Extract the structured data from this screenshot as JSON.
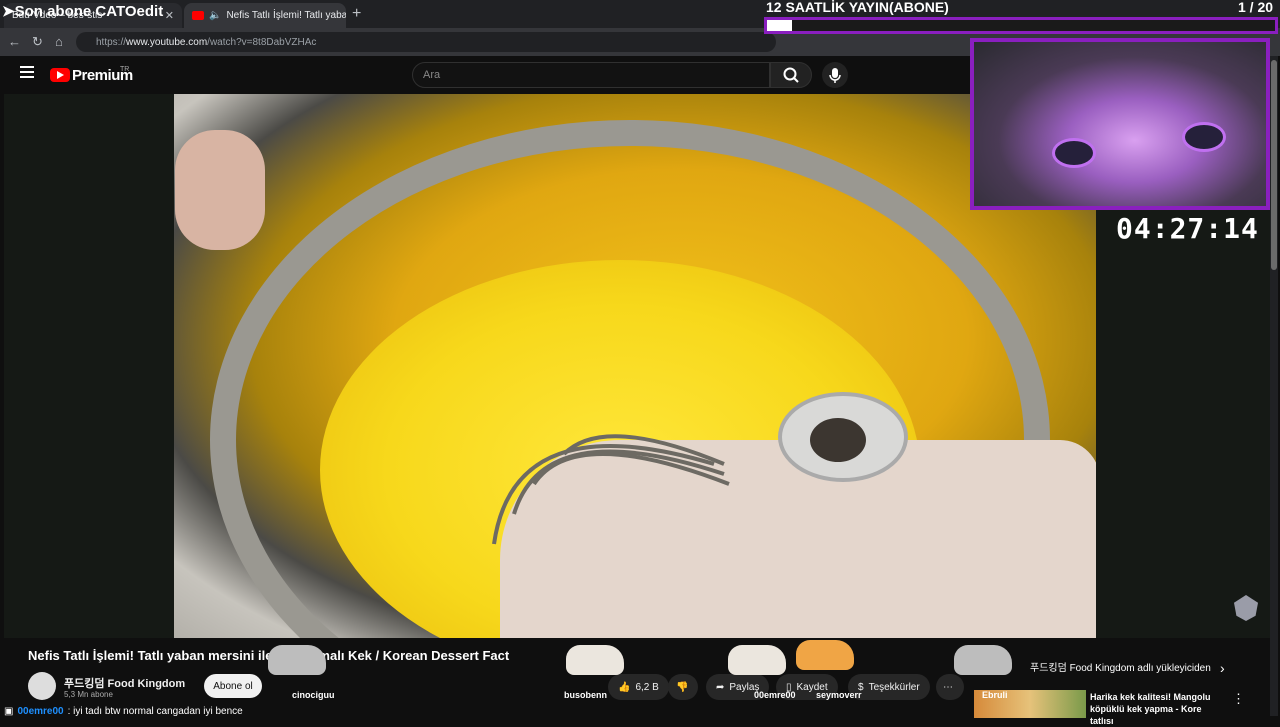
{
  "browser": {
    "tabs": [
      {
        "label": "Bdu·Vdeo – bes•stis"
      },
      {
        "label": "Nefis Tatlı İşlemi! Tatlı yaban mersini"
      }
    ],
    "new_tab": "+",
    "url_prefix": "https://",
    "url_host": "www.youtube.com",
    "url_path": "/watch?v=8t8DabVZHAc"
  },
  "youtube": {
    "logo_text": "Premium",
    "logo_suffix": "TR",
    "search_placeholder": "Ara"
  },
  "overlay": {
    "corner_text": "➤Son abone CATOedit",
    "stream_title": "12 SAATLİK YAYIN(ABONE)",
    "goal_counter": "1 / 20",
    "goal_progress": 0.05,
    "timer": "04:27:14",
    "cat_names": [
      "cinociguu",
      "busobenn",
      "00emre00",
      "seymoverr"
    ]
  },
  "video_info": {
    "title": "Nefis Tatlı İşlemi! Tatlı yaban mersini ile y... Kremalı Kek / Korean Dessert Fact",
    "channel": "푸드킹덤 Food Kingdom",
    "subscribers": "5,3 Mn abone",
    "subscribe_label": "Abone ol",
    "like_count": "6,2 B",
    "share_label": "Paylaş",
    "save_label": "Kaydet",
    "thanks_label": "Teşekkürler",
    "more_label": "⋯"
  },
  "sidebar": {
    "uploader_label": "푸드킹덤 Food Kingdom adlı yükleyiciden",
    "next_video_title": "Harika kek kalitesi! Mangolu köpüklü kek yapma - Kore tatlısı",
    "thumb_label": "Ebruli"
  },
  "chat": {
    "username": "00emre00",
    "message": ": iyi tadı btw normal cangadan iyi bence"
  },
  "colors": {
    "accent_purple": "#8a1fbf",
    "youtube_red": "#ff0000",
    "chat_user": "#1e90ff"
  }
}
